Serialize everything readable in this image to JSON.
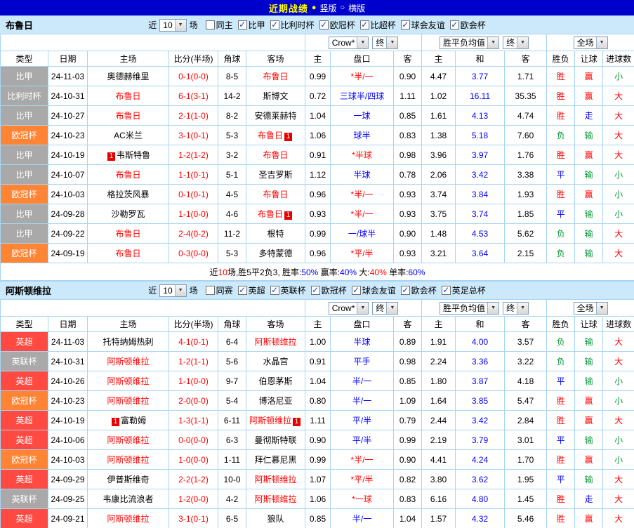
{
  "topbar": {
    "title": "近期战绩",
    "selected_marker": "●",
    "vertical_label": "竖版",
    "unselected_marker": "○",
    "horizontal_label": "横版"
  },
  "filters": {
    "near_label": "近",
    "games_count": "10",
    "games_unit": "场",
    "odds_company": "Crow*",
    "final_label": "终",
    "avg_label": "胜平负均值",
    "scope_label": "全场"
  },
  "table_headers": [
    "类型",
    "日期",
    "主场",
    "比分(半场)",
    "角球",
    "客场",
    "主",
    "盘口",
    "客",
    "主",
    "和",
    "客",
    "胜负",
    "让球",
    "进球数"
  ],
  "palette": {
    "red": "#ff0000",
    "blue": "#0000ff",
    "green": "#009933",
    "black": "#000000",
    "league_grey": "#a9a9a9",
    "league_orange": "#ff8433",
    "league_red": "#ff4a43"
  },
  "sections": [
    {
      "team": "布鲁日",
      "same_checkbox": {
        "label": "同主",
        "checked": false
      },
      "league_checkboxes": [
        {
          "label": "比甲",
          "checked": true
        },
        {
          "label": "比利时杯",
          "checked": true
        },
        {
          "label": "欧冠杯",
          "checked": true
        },
        {
          "label": "比超杯",
          "checked": true
        },
        {
          "label": "球会友谊",
          "checked": true
        },
        {
          "label": "欧会杯",
          "checked": true
        }
      ],
      "rows": [
        {
          "league": "比甲",
          "ltype": "grey",
          "date": "24-11-03",
          "home": {
            "name": "奥德赫维里"
          },
          "score": "0-1(0-0)",
          "corners": "8-5",
          "away": {
            "name": "布鲁日",
            "hl": true
          },
          "ah_home": "0.99",
          "ah_line": "*半/一",
          "ah_lc": "red",
          "ah_away": "0.90",
          "eu_home": "4.47",
          "eu_draw": "3.77",
          "eu_away": "1.71",
          "res": {
            "t": "胜",
            "c": "red"
          },
          "cover": {
            "t": "赢",
            "c": "red"
          },
          "ou": {
            "t": "小",
            "c": "green"
          }
        },
        {
          "league": "比利时杯",
          "ltype": "grey",
          "date": "24-10-31",
          "home": {
            "name": "布鲁日",
            "hl": true
          },
          "score": "6-1(3-1)",
          "corners": "14-2",
          "away": {
            "name": "斯博文"
          },
          "ah_home": "0.72",
          "ah_line": "三球半/四球",
          "ah_lc": "blue",
          "ah_away": "1.11",
          "eu_home": "1.02",
          "eu_draw": "16.11",
          "eu_away": "35.35",
          "res": {
            "t": "胜",
            "c": "red"
          },
          "cover": {
            "t": "赢",
            "c": "red"
          },
          "ou": {
            "t": "大",
            "c": "red"
          }
        },
        {
          "league": "比甲",
          "ltype": "grey",
          "date": "24-10-27",
          "home": {
            "name": "布鲁日",
            "hl": true
          },
          "score": "2-1(1-0)",
          "corners": "8-2",
          "away": {
            "name": "安德莱赫特"
          },
          "ah_home": "1.04",
          "ah_line": "一球",
          "ah_lc": "blue",
          "ah_away": "0.85",
          "eu_home": "1.61",
          "eu_draw": "4.13",
          "eu_away": "4.74",
          "res": {
            "t": "胜",
            "c": "red"
          },
          "cover": {
            "t": "走",
            "c": "blue"
          },
          "ou": {
            "t": "大",
            "c": "red"
          }
        },
        {
          "league": "欧冠杯",
          "ltype": "orange",
          "date": "24-10-23",
          "home": {
            "name": "AC米兰"
          },
          "score": "3-1(0-1)",
          "corners": "5-3",
          "away": {
            "name": "布鲁日",
            "hl": true,
            "badge_post": "1"
          },
          "ah_home": "1.06",
          "ah_line": "球半",
          "ah_lc": "blue",
          "ah_away": "0.83",
          "eu_home": "1.38",
          "eu_draw": "5.18",
          "eu_away": "7.60",
          "res": {
            "t": "负",
            "c": "green"
          },
          "cover": {
            "t": "输",
            "c": "green"
          },
          "ou": {
            "t": "大",
            "c": "red"
          }
        },
        {
          "league": "比甲",
          "ltype": "grey",
          "date": "24-10-19",
          "home": {
            "name": "韦斯特鲁",
            "badge_pre": "1"
          },
          "score": "1-2(1-2)",
          "corners": "3-2",
          "away": {
            "name": "布鲁日",
            "hl": true
          },
          "ah_home": "0.91",
          "ah_line": "*半球",
          "ah_lc": "red",
          "ah_away": "0.98",
          "eu_home": "3.96",
          "eu_draw": "3.97",
          "eu_away": "1.76",
          "res": {
            "t": "胜",
            "c": "red"
          },
          "cover": {
            "t": "赢",
            "c": "red"
          },
          "ou": {
            "t": "大",
            "c": "red"
          }
        },
        {
          "league": "比甲",
          "ltype": "grey",
          "date": "24-10-07",
          "home": {
            "name": "布鲁日",
            "hl": true
          },
          "score": "1-1(0-1)",
          "corners": "5-1",
          "away": {
            "name": "圣吉罗斯"
          },
          "ah_home": "1.12",
          "ah_line": "半球",
          "ah_lc": "blue",
          "ah_away": "0.78",
          "eu_home": "2.06",
          "eu_draw": "3.42",
          "eu_away": "3.38",
          "res": {
            "t": "平",
            "c": "blue"
          },
          "cover": {
            "t": "输",
            "c": "green"
          },
          "ou": {
            "t": "小",
            "c": "green"
          }
        },
        {
          "league": "欧冠杯",
          "ltype": "orange",
          "date": "24-10-03",
          "home": {
            "name": "格拉茨风暴"
          },
          "score": "0-1(0-1)",
          "corners": "4-5",
          "away": {
            "name": "布鲁日",
            "hl": true
          },
          "ah_home": "0.96",
          "ah_line": "*半/一",
          "ah_lc": "red",
          "ah_away": "0.93",
          "eu_home": "3.74",
          "eu_draw": "3.84",
          "eu_away": "1.93",
          "res": {
            "t": "胜",
            "c": "red"
          },
          "cover": {
            "t": "赢",
            "c": "red"
          },
          "ou": {
            "t": "小",
            "c": "green"
          }
        },
        {
          "league": "比甲",
          "ltype": "grey",
          "date": "24-09-28",
          "home": {
            "name": "沙勒罗瓦"
          },
          "score": "1-1(0-0)",
          "corners": "4-6",
          "away": {
            "name": "布鲁日",
            "hl": true,
            "badge_post": "1"
          },
          "ah_home": "0.93",
          "ah_line": "*半/一",
          "ah_lc": "red",
          "ah_away": "0.93",
          "eu_home": "3.75",
          "eu_draw": "3.74",
          "eu_away": "1.85",
          "res": {
            "t": "平",
            "c": "blue"
          },
          "cover": {
            "t": "输",
            "c": "green"
          },
          "ou": {
            "t": "小",
            "c": "green"
          }
        },
        {
          "league": "比甲",
          "ltype": "grey",
          "date": "24-09-22",
          "home": {
            "name": "布鲁日",
            "hl": true
          },
          "score": "2-4(0-2)",
          "corners": "11-2",
          "away": {
            "name": "根特"
          },
          "ah_home": "0.99",
          "ah_line": "一/球半",
          "ah_lc": "blue",
          "ah_away": "0.90",
          "eu_home": "1.48",
          "eu_draw": "4.53",
          "eu_away": "5.62",
          "res": {
            "t": "负",
            "c": "green"
          },
          "cover": {
            "t": "输",
            "c": "green"
          },
          "ou": {
            "t": "大",
            "c": "red"
          }
        },
        {
          "league": "欧冠杯",
          "ltype": "orange",
          "date": "24-09-19",
          "home": {
            "name": "布鲁日",
            "hl": true
          },
          "score": "0-3(0-0)",
          "corners": "5-3",
          "away": {
            "name": "多特蒙德"
          },
          "ah_home": "0.96",
          "ah_line": "*平/半",
          "ah_lc": "red",
          "ah_away": "0.93",
          "eu_home": "3.21",
          "eu_draw": "3.64",
          "eu_away": "2.15",
          "res": {
            "t": "负",
            "c": "green"
          },
          "cover": {
            "t": "输",
            "c": "green"
          },
          "ou": {
            "t": "大",
            "c": "red"
          }
        }
      ],
      "summary": [
        {
          "t": "近",
          "c": "black"
        },
        {
          "t": "10",
          "c": "red"
        },
        {
          "t": "场,胜5平2负3, 胜率:",
          "c": "black"
        },
        {
          "t": "50%",
          "c": "blue"
        },
        {
          "t": " 赢率:",
          "c": "black"
        },
        {
          "t": "40%",
          "c": "blue"
        },
        {
          "t": " 大:",
          "c": "black"
        },
        {
          "t": "40%",
          "c": "red"
        },
        {
          "t": " 单率:",
          "c": "black"
        },
        {
          "t": "60%",
          "c": "blue"
        }
      ]
    },
    {
      "team": "阿斯顿维拉",
      "same_checkbox": {
        "label": "同赛",
        "checked": false
      },
      "league_checkboxes": [
        {
          "label": "英超",
          "checked": true
        },
        {
          "label": "英联杯",
          "checked": true
        },
        {
          "label": "欧冠杯",
          "checked": true
        },
        {
          "label": "球会友谊",
          "checked": true
        },
        {
          "label": "欧会杯",
          "checked": true
        },
        {
          "label": "英足总杯",
          "checked": true
        }
      ],
      "rows": [
        {
          "league": "英超",
          "ltype": "red",
          "date": "24-11-03",
          "home": {
            "name": "托特纳姆热刺"
          },
          "score": "4-1(0-1)",
          "corners": "6-4",
          "away": {
            "name": "阿斯顿维拉",
            "hl": true
          },
          "ah_home": "1.00",
          "ah_line": "半球",
          "ah_lc": "blue",
          "ah_away": "0.89",
          "eu_home": "1.91",
          "eu_draw": "4.00",
          "eu_away": "3.57",
          "res": {
            "t": "负",
            "c": "green"
          },
          "cover": {
            "t": "输",
            "c": "green"
          },
          "ou": {
            "t": "大",
            "c": "red"
          }
        },
        {
          "league": "英联杯",
          "ltype": "grey",
          "date": "24-10-31",
          "home": {
            "name": "阿斯顿维拉",
            "hl": true
          },
          "score": "1-2(1-1)",
          "corners": "5-6",
          "away": {
            "name": "水晶宫"
          },
          "ah_home": "0.91",
          "ah_line": "平手",
          "ah_lc": "blue",
          "ah_away": "0.98",
          "eu_home": "2.24",
          "eu_draw": "3.36",
          "eu_away": "3.22",
          "res": {
            "t": "负",
            "c": "green"
          },
          "cover": {
            "t": "输",
            "c": "green"
          },
          "ou": {
            "t": "大",
            "c": "red"
          }
        },
        {
          "league": "英超",
          "ltype": "red",
          "date": "24-10-26",
          "home": {
            "name": "阿斯顿维拉",
            "hl": true
          },
          "score": "1-1(0-0)",
          "corners": "9-7",
          "away": {
            "name": "伯恩茅斯"
          },
          "ah_home": "1.04",
          "ah_line": "半/一",
          "ah_lc": "blue",
          "ah_away": "0.85",
          "eu_home": "1.80",
          "eu_draw": "3.87",
          "eu_away": "4.18",
          "res": {
            "t": "平",
            "c": "blue"
          },
          "cover": {
            "t": "输",
            "c": "green"
          },
          "ou": {
            "t": "小",
            "c": "green"
          }
        },
        {
          "league": "欧冠杯",
          "ltype": "orange",
          "date": "24-10-23",
          "home": {
            "name": "阿斯顿维拉",
            "hl": true
          },
          "score": "2-0(0-0)",
          "corners": "5-4",
          "away": {
            "name": "博洛尼亚"
          },
          "ah_home": "0.80",
          "ah_line": "半/一",
          "ah_lc": "blue",
          "ah_away": "1.09",
          "eu_home": "1.64",
          "eu_draw": "3.85",
          "eu_away": "5.47",
          "res": {
            "t": "胜",
            "c": "red"
          },
          "cover": {
            "t": "赢",
            "c": "red"
          },
          "ou": {
            "t": "小",
            "c": "green"
          }
        },
        {
          "league": "英超",
          "ltype": "red",
          "date": "24-10-19",
          "home": {
            "name": "富勒姆",
            "badge_pre": "1"
          },
          "score": "1-3(1-1)",
          "corners": "6-11",
          "away": {
            "name": "阿斯顿维拉",
            "hl": true,
            "badge_post": "1"
          },
          "ah_home": "1.11",
          "ah_line": "平/半",
          "ah_lc": "blue",
          "ah_away": "0.79",
          "eu_home": "2.44",
          "eu_draw": "3.42",
          "eu_away": "2.84",
          "res": {
            "t": "胜",
            "c": "red"
          },
          "cover": {
            "t": "赢",
            "c": "red"
          },
          "ou": {
            "t": "大",
            "c": "red"
          }
        },
        {
          "league": "英超",
          "ltype": "red",
          "date": "24-10-06",
          "home": {
            "name": "阿斯顿维拉",
            "hl": true
          },
          "score": "0-0(0-0)",
          "corners": "6-3",
          "away": {
            "name": "曼彻斯特联"
          },
          "ah_home": "0.90",
          "ah_line": "平/半",
          "ah_lc": "blue",
          "ah_away": "0.99",
          "eu_home": "2.19",
          "eu_draw": "3.79",
          "eu_away": "3.01",
          "res": {
            "t": "平",
            "c": "blue"
          },
          "cover": {
            "t": "输",
            "c": "green"
          },
          "ou": {
            "t": "小",
            "c": "green"
          }
        },
        {
          "league": "欧冠杯",
          "ltype": "orange",
          "date": "24-10-03",
          "home": {
            "name": "阿斯顿维拉",
            "hl": true
          },
          "score": "1-0(0-0)",
          "corners": "1-11",
          "away": {
            "name": "拜仁慕尼黑"
          },
          "ah_home": "0.99",
          "ah_line": "*半/一",
          "ah_lc": "red",
          "ah_away": "0.90",
          "eu_home": "4.41",
          "eu_draw": "4.24",
          "eu_away": "1.70",
          "res": {
            "t": "胜",
            "c": "red"
          },
          "cover": {
            "t": "赢",
            "c": "red"
          },
          "ou": {
            "t": "小",
            "c": "green"
          }
        },
        {
          "league": "英超",
          "ltype": "red",
          "date": "24-09-29",
          "home": {
            "name": "伊普斯维奇"
          },
          "score": "2-2(1-2)",
          "corners": "10-0",
          "away": {
            "name": "阿斯顿维拉",
            "hl": true
          },
          "ah_home": "1.07",
          "ah_line": "*平/半",
          "ah_lc": "red",
          "ah_away": "0.82",
          "eu_home": "3.80",
          "eu_draw": "3.62",
          "eu_away": "1.95",
          "res": {
            "t": "平",
            "c": "blue"
          },
          "cover": {
            "t": "输",
            "c": "green"
          },
          "ou": {
            "t": "大",
            "c": "red"
          }
        },
        {
          "league": "英联杯",
          "ltype": "grey",
          "date": "24-09-25",
          "home": {
            "name": "韦康比流浪者"
          },
          "score": "1-2(0-0)",
          "corners": "4-2",
          "away": {
            "name": "阿斯顿维拉",
            "hl": true
          },
          "ah_home": "1.06",
          "ah_line": "*一球",
          "ah_lc": "red",
          "ah_away": "0.83",
          "eu_home": "6.16",
          "eu_draw": "4.80",
          "eu_away": "1.45",
          "res": {
            "t": "胜",
            "c": "red"
          },
          "cover": {
            "t": "走",
            "c": "blue"
          },
          "ou": {
            "t": "大",
            "c": "red"
          }
        },
        {
          "league": "英超",
          "ltype": "red",
          "date": "24-09-21",
          "home": {
            "name": "阿斯顿维拉",
            "hl": true
          },
          "score": "3-1(0-1)",
          "corners": "6-5",
          "away": {
            "name": "狼队"
          },
          "ah_home": "0.85",
          "ah_line": "半/一",
          "ah_lc": "blue",
          "ah_away": "1.04",
          "eu_home": "1.57",
          "eu_draw": "4.32",
          "eu_away": "5.46",
          "res": {
            "t": "胜",
            "c": "red"
          },
          "cover": {
            "t": "赢",
            "c": "red"
          },
          "ou": {
            "t": "大",
            "c": "red"
          }
        }
      ]
    }
  ]
}
